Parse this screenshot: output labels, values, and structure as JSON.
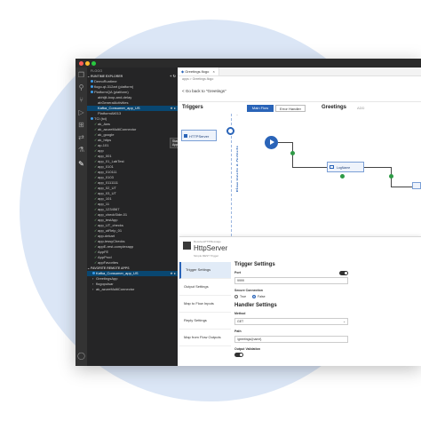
{
  "sidebar": {
    "header": "FLOGO",
    "runtime_explorer": "RUNTIME EXPLORER",
    "favorite_section": "FAVORITE REMOTE APPS",
    "tooltip": "Start App",
    "items": [
      {
        "label": "DemoRuntime",
        "indent": 2,
        "glyph": "dot",
        "color": "#3c9be8"
      },
      {
        "label": "flogo-qt-312art (platform)",
        "indent": 2,
        "glyph": "dot",
        "color": "#3c9be8"
      },
      {
        "label": "PlatformQA (platform)",
        "indent": 2,
        "glyph": "dot",
        "color": "#3c9be8"
      },
      {
        "label": "abhijit-loop-and-delay",
        "indent": 4,
        "glyph": "none"
      },
      {
        "label": "abGeneralActivities",
        "indent": 4,
        "glyph": "none"
      },
      {
        "label": "Kafka_Consumer_app_US",
        "indent": 4,
        "glyph": "none",
        "selected": true
      },
      {
        "label": "PlatformAlt013",
        "indent": 4,
        "glyph": "none"
      },
      {
        "label": "TCI (tci)",
        "indent": 2,
        "glyph": "dot",
        "color": "#3c9be8"
      },
      {
        "label": "ak_Aws",
        "indent": 4,
        "glyph": "check"
      },
      {
        "label": "ak_azureMultiConnector",
        "indent": 4,
        "glyph": "check"
      },
      {
        "label": "ak_google",
        "indent": 4,
        "glyph": "check"
      },
      {
        "label": "ak_https",
        "indent": 4,
        "glyph": "check"
      },
      {
        "label": "ap-101",
        "indent": 4,
        "glyph": "check"
      },
      {
        "label": "app",
        "indent": 4,
        "glyph": "check"
      },
      {
        "label": "app_001",
        "indent": 4,
        "glyph": "check"
      },
      {
        "label": "app_01_LabTest",
        "indent": 4,
        "glyph": "check"
      },
      {
        "label": "app_0101",
        "indent": 4,
        "glyph": "check"
      },
      {
        "label": "app_010111",
        "indent": 4,
        "glyph": "check"
      },
      {
        "label": "app_0103",
        "indent": 4,
        "glyph": "check"
      },
      {
        "label": "app_0111111",
        "indent": 4,
        "glyph": "check"
      },
      {
        "label": "app_02_UT",
        "indent": 4,
        "glyph": "check"
      },
      {
        "label": "app_03_UT",
        "indent": 4,
        "glyph": "check"
      },
      {
        "label": "app_101",
        "indent": 4,
        "glyph": "check"
      },
      {
        "label": "app_11",
        "indent": 4,
        "glyph": "check"
      },
      {
        "label": "app_1234567",
        "indent": 4,
        "glyph": "check"
      },
      {
        "label": "app_checkSide-01",
        "indent": 4,
        "glyph": "check"
      },
      {
        "label": "app_testApp",
        "indent": 4,
        "glyph": "check"
      },
      {
        "label": "app_UT_checks",
        "indent": 4,
        "glyph": "check"
      },
      {
        "label": "app_utRelp_01",
        "indent": 4,
        "glyph": "check"
      },
      {
        "label": "app-dekart",
        "indent": 4,
        "glyph": "check"
      },
      {
        "label": "app-lessyChecks",
        "indent": 4,
        "glyph": "check"
      },
      {
        "label": "appE-rest-complexapp",
        "indent": 4,
        "glyph": "check"
      },
      {
        "label": "AppFE",
        "indent": 4,
        "glyph": "check"
      },
      {
        "label": "AppProd",
        "indent": 4,
        "glyph": "check"
      },
      {
        "label": "appFavorites",
        "indent": 4,
        "glyph": "check"
      }
    ],
    "favorites": [
      {
        "label": "Kafka_Consumer_app_US",
        "glyph": "dot",
        "color": "#3c9be8",
        "selected": true
      },
      {
        "label": "GreetingsApp",
        "glyph": "chev"
      },
      {
        "label": "flogopulsar",
        "glyph": "chev"
      },
      {
        "label": "ak_azureMultiConnector",
        "glyph": "chev"
      }
    ]
  },
  "editor": {
    "tab_label": "Greetings.flogo",
    "breadcrumb": "apps > Greetings.flogo",
    "back_link": "< Go back to \"Greetings\"",
    "triggers_title": "Triggers",
    "main_flow_btn": "Main Flow",
    "error_handler_btn": "Error Handler",
    "flow_title": "Greetings",
    "add_tab": "ADD",
    "trigger_card": "HTTPServer",
    "vertical_label": "Flow Inputs & Outputs",
    "activity_label": "LogName"
  },
  "panel": {
    "small_label": "ReceiveHTTPMessage",
    "title": "HttpServer",
    "desc": "Simple REST Trigger",
    "nav": [
      "Trigger Settings",
      "Output Settings",
      "Map to Flow Inputs",
      "Reply Settings",
      "Map from Flow Outputs"
    ],
    "trigger_settings_heading": "Trigger Settings",
    "port_label": "Port",
    "port_value": "9999",
    "secure_label": "Secure Connection",
    "radio_true": "True",
    "radio_false": "False",
    "handler_heading": "Handler Settings",
    "method_label": "Method",
    "method_value": "GET",
    "path_label": "Path",
    "path_value": "/greetings/{name}",
    "output_validation_label": "Output Validation"
  },
  "colors": {
    "accent": "#2a64b8",
    "sidebar_bg": "#252526",
    "activity_bg": "#333333",
    "success": "#2e9a46"
  }
}
